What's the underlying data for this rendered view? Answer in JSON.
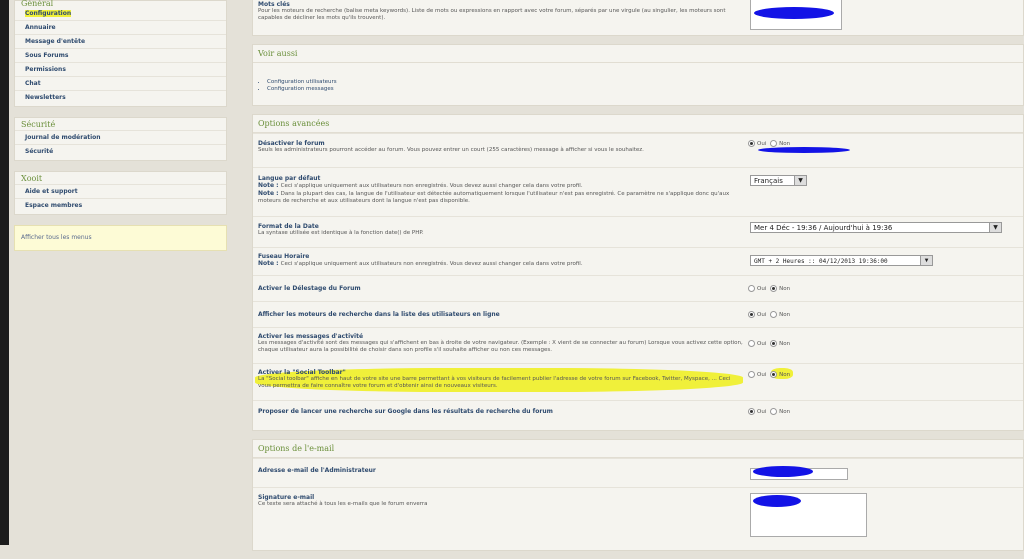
{
  "sidebar": {
    "general": {
      "title": "Général",
      "items": [
        "Configuration",
        "Annuaire",
        "Message d'entête",
        "Sous Forums",
        "Permissions",
        "Chat",
        "Newsletters"
      ]
    },
    "securite": {
      "title": "Sécurité",
      "items": [
        "Journal de modération",
        "Sécurité"
      ]
    },
    "xooit": {
      "title": "Xooit",
      "items": [
        "Aide et support",
        "Espace membres"
      ]
    },
    "show_all": "Afficher tous les menus"
  },
  "top": {
    "label": "Mots clés",
    "desc": "Pour les moteurs de recherche (balise meta keywords). Liste de mots ou expressions en rapport avec votre forum, séparés par une virgule (au singulier, les moteurs sont capables de décliner les mots qu'ils trouvent)."
  },
  "voir_aussi": {
    "title": "Voir aussi",
    "links": [
      "Configuration utilisateurs",
      "Configuration messages"
    ]
  },
  "options": {
    "title": "Options avancées",
    "oui": "Oui",
    "non": "Non",
    "disable_label": "Désactiver le forum",
    "disable_desc": "Seuls les administrateurs pourront accéder au forum. Vous pouvez entrer un court (255 caractères) message à afficher si vous le souhaitez.",
    "lang_label": "Langue par défaut",
    "lang_note1_a": "Note : ",
    "lang_note1": "Ceci s'applique uniquement aux utilisateurs non enregistrés. Vous devez aussi changer cela dans votre profil.",
    "lang_note2_a": "Note : ",
    "lang_note2": "Dans la plupart des cas, la langue de l'utilisateur est détectée automatiquement lorsque l'utilisateur n'est pas enregistré. Ce paramètre ne s'applique donc qu'aux moteurs de recherche et aux utilisateurs dont la langue n'est pas disponible.",
    "lang_value": "Français",
    "date_label": "Format de la Date",
    "date_desc": "La syntaxe utilisée est identique à la fonction date() de PHP.",
    "date_value": "Mer 4 Déc - 19:36 / Aujourd'hui à 19:36",
    "tz_label": "Fuseau Horaire",
    "tz_note_a": "Note : ",
    "tz_note": "Ceci s'applique uniquement aux utilisateurs non enregistrés. Vous devez aussi changer cela dans votre profil.",
    "tz_value": "GMT + 2 Heures     :: 04/12/2013 19:36:00",
    "delestage_label": "Activer le Délestage du Forum",
    "engines_label": "Afficher les moteurs de recherche dans la liste des utilisateurs en ligne",
    "activity_label": "Activer les messages d'activité",
    "activity_desc": "Les messages d'activité sont des messages qui s'affichent en bas à droite de votre navigateur. (Exemple : X vient de se connecter au forum) Lorsque vous activez cette option, chaque utilisateur aura la possibilité de choisir dans son profile s'il souhaite afficher ou non ces messages.",
    "social_label": "Activer la \"Social Toolbar\"",
    "social_desc": "La \"Social toolbar\" affiche en haut de votre site une barre permettant à vos visiteurs de facilement publier l'adresse de votre forum sur Facebook, Twitter, Myspace, ... Ceci vous permettra de faire connaître votre forum et d'obtenir ainsi de nouveaux visiteurs.",
    "google_label": "Proposer de lancer une recherche sur Google dans les résultats de recherche du forum"
  },
  "email": {
    "title": "Options de l'e-mail",
    "admin_label": "Adresse e-mail de l'Administrateur",
    "sig_label": "Signature e-mail",
    "sig_desc": "Ce texte sera attaché à tous les e-mails que le forum enverra"
  }
}
